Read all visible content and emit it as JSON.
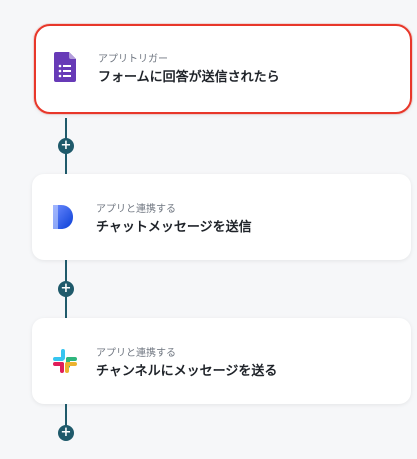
{
  "flow": {
    "steps": [
      {
        "subtitle": "アプリトリガー",
        "title": "フォームに回答が送信されたら",
        "icon": "google-forms-icon",
        "selected": true
      },
      {
        "subtitle": "アプリと連携する",
        "title": "チャットメッセージを送信",
        "icon": "dify-icon",
        "selected": false
      },
      {
        "subtitle": "アプリと連携する",
        "title": "チャンネルにメッセージを送る",
        "icon": "slack-icon",
        "selected": false
      }
    ],
    "add_button_symbol": "+"
  },
  "colors": {
    "selected_border": "#e8372a",
    "connector": "#1f5a6b",
    "google_forms_purple": "#673ab7",
    "dify_blue": "#1c64f2"
  }
}
